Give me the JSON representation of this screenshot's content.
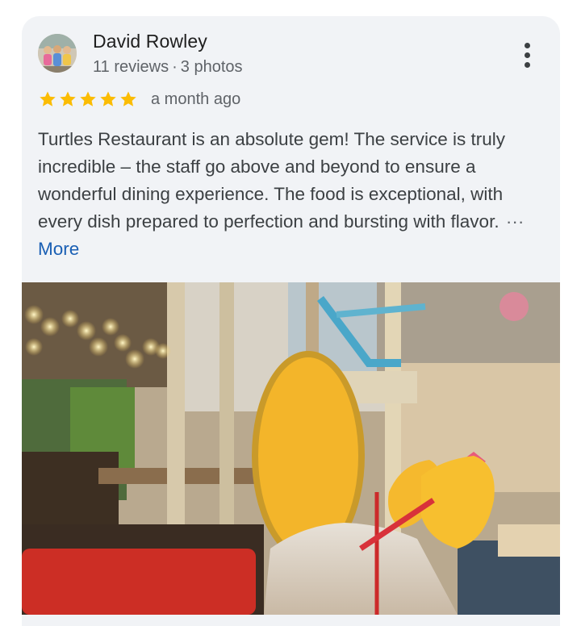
{
  "review": {
    "author": {
      "name": "David Rowley",
      "reviews": "11 reviews",
      "separator": "·",
      "photos": "3 photos"
    },
    "rating": {
      "stars": 5,
      "max": 5,
      "star_color": "#fbbc04"
    },
    "time": "a month ago",
    "text": "Turtles Restaurant is an absolute gem! The service is truly incredible – the staff go above and beyond to ensure a wonderful dining experience. The food is exceptional, with every dish prepared to perfection and bursting with flavor.",
    "ellipsis": "···",
    "more_label": "More",
    "menu_icon": "more-vert-icon"
  },
  "colors": {
    "card_bg": "#f1f3f6",
    "link": "#1a5fb4",
    "secondary_text": "#5f6368"
  }
}
